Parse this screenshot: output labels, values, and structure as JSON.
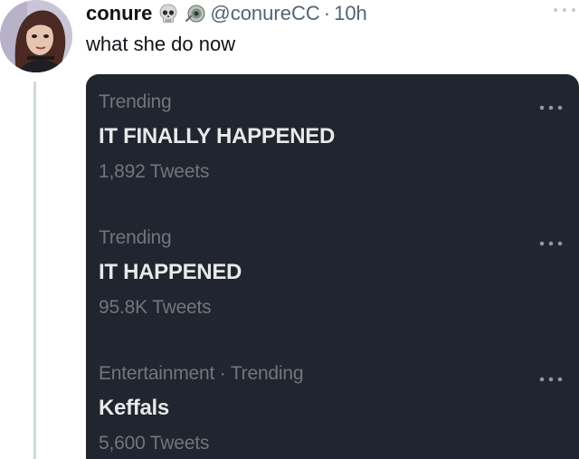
{
  "tweet": {
    "display_name": "conure",
    "handle": "@conureCC",
    "separator": "·",
    "time": "10h",
    "text": "what she do now",
    "emojis": [
      "skull-emoji",
      "boomerang-emoji"
    ]
  },
  "trends": [
    {
      "context": "Trending",
      "title": "IT FINALLY HAPPENED",
      "count": "1,892 Tweets"
    },
    {
      "context": "Trending",
      "title": "IT HAPPENED",
      "count": "95.8K Tweets"
    },
    {
      "context": "Entertainment · Trending",
      "title": "Keffals",
      "count": "5,600 Tweets"
    }
  ],
  "colors": {
    "card_background": "#212530",
    "trend_title": "#e7e9ea",
    "trend_meta": "#71767b",
    "name_text": "#0f1419",
    "handle_text": "#536471",
    "thread_line": "#cfd9de"
  }
}
